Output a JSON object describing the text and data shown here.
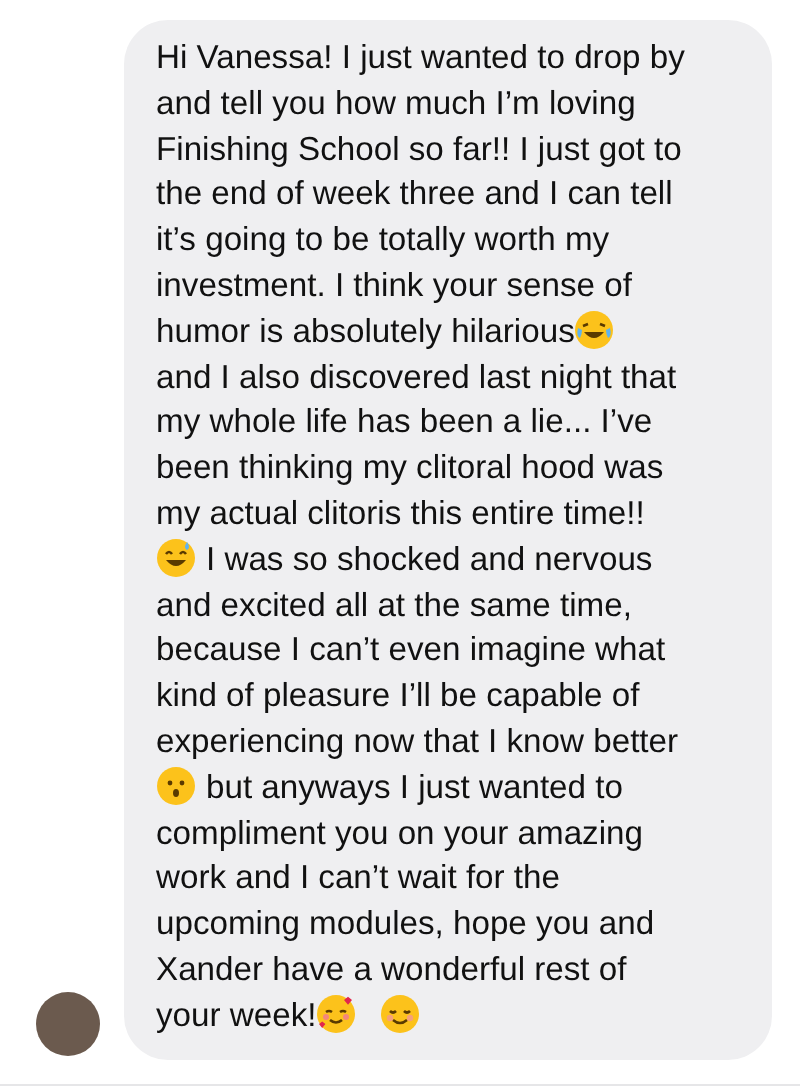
{
  "message": {
    "lines": [
      [
        {
          "kind": "text",
          "text": "Hi Vanessa! I just wanted to drop by"
        }
      ],
      [
        {
          "kind": "text",
          "text": "and tell you how much I’m loving"
        }
      ],
      [
        {
          "kind": "text",
          "text": "Finishing School so far!! I just got to"
        }
      ],
      [
        {
          "kind": "text",
          "text": "the end of week three and I can tell"
        }
      ],
      [
        {
          "kind": "text",
          "text": "it’s going to be totally worth my"
        }
      ],
      [
        {
          "kind": "text",
          "text": "investment. I think your sense of"
        }
      ],
      [
        {
          "kind": "text",
          "text": "humor is absolutely hilarious"
        },
        {
          "kind": "laughing"
        }
      ],
      [
        {
          "kind": "text",
          "text": "and I also discovered last night that"
        }
      ],
      [
        {
          "kind": "text",
          "text": "my whole life has been a lie... I’ve"
        }
      ],
      [
        {
          "kind": "text",
          "text": "been thinking my clitoral hood was"
        }
      ],
      [
        {
          "kind": "text",
          "text": "my actual clitoris this entire time!!"
        }
      ],
      [
        {
          "kind": "sweat"
        },
        {
          "kind": "text",
          "text": "I was so shocked and nervous"
        }
      ],
      [
        {
          "kind": "text",
          "text": "and excited all at the same time,"
        }
      ],
      [
        {
          "kind": "text",
          "text": "because I can’t even imagine what"
        }
      ],
      [
        {
          "kind": "text",
          "text": "kind of pleasure I’ll be capable of"
        }
      ],
      [
        {
          "kind": "text",
          "text": "experiencing now that I know better"
        }
      ],
      [
        {
          "kind": "hushed"
        },
        {
          "kind": "text",
          "text": "but anyways I just wanted to"
        }
      ],
      [
        {
          "kind": "text",
          "text": "compliment you on your amazing"
        }
      ],
      [
        {
          "kind": "text",
          "text": "work and I can’t wait for the"
        }
      ],
      [
        {
          "kind": "text",
          "text": "upcoming modules, hope you and"
        }
      ],
      [
        {
          "kind": "text",
          "text": "Xander have a wonderful rest of"
        }
      ],
      [
        {
          "kind": "text",
          "text": "your week!"
        },
        {
          "kind": "hearts"
        },
        {
          "kind": "smiling"
        }
      ]
    ]
  }
}
